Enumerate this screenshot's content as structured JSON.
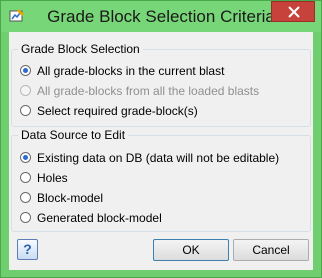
{
  "window": {
    "title": "Grade Block Selection Criteria",
    "close_label": "×"
  },
  "grade_block_selection": {
    "title": "Grade Block Selection",
    "options": [
      {
        "label": "All grade-blocks in the current blast",
        "checked": true,
        "disabled": false
      },
      {
        "label": "All grade-blocks from all the loaded blasts",
        "checked": false,
        "disabled": true
      },
      {
        "label": "Select required grade-block(s)",
        "checked": false,
        "disabled": false
      }
    ]
  },
  "data_source": {
    "title": "Data Source to Edit",
    "options": [
      {
        "label": "Existing data on DB (data will not be editable)",
        "checked": true
      },
      {
        "label": "Holes",
        "checked": false
      },
      {
        "label": "Block-model",
        "checked": false
      },
      {
        "label": "Generated block-model",
        "checked": false
      }
    ]
  },
  "buttons": {
    "help": "?",
    "ok": "OK",
    "cancel": "Cancel"
  }
}
